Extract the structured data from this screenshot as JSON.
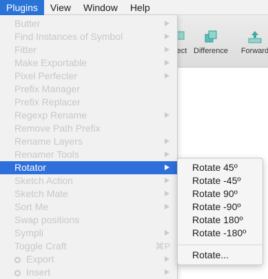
{
  "menubar": {
    "items": [
      {
        "label": "Plugins",
        "active": true
      },
      {
        "label": "View"
      },
      {
        "label": "Window"
      },
      {
        "label": "Help"
      }
    ]
  },
  "toolbar": {
    "intersect_label": "ect",
    "difference_label": "Difference",
    "forward_label": "Forward",
    "icon_color": "#3fa8a0"
  },
  "plugins_menu": {
    "items": [
      {
        "label": "Butter",
        "submenu": true
      },
      {
        "label": "Find Instances of Symbol",
        "submenu": true
      },
      {
        "label": "Fitter",
        "submenu": true
      },
      {
        "label": "Make Exportable",
        "submenu": true
      },
      {
        "label": "Pixel Perfecter",
        "submenu": true
      },
      {
        "label": "Prefix Manager",
        "submenu": false
      },
      {
        "label": "Prefix Replacer",
        "submenu": false
      },
      {
        "label": "Regexp Rename",
        "submenu": true
      },
      {
        "label": "Remove Path Prefix",
        "submenu": false
      },
      {
        "label": "Rename Layers",
        "submenu": true
      },
      {
        "label": "Renamer Tools",
        "submenu": true
      },
      {
        "label": "Rotator",
        "submenu": true,
        "selected": true
      },
      {
        "label": "Sketch Action",
        "submenu": true
      },
      {
        "label": "Sketch Mate",
        "submenu": true
      },
      {
        "label": "Sort Me",
        "submenu": true
      },
      {
        "label": "Swap positions",
        "submenu": false
      },
      {
        "label": "Sympli",
        "submenu": true
      },
      {
        "label": "Toggle Craft",
        "shortcut": "⌘P"
      },
      {
        "label": "Export",
        "submenu": true,
        "icon": "gear-icon"
      },
      {
        "label": "Insert",
        "submenu": true,
        "icon": "gear-icon"
      }
    ]
  },
  "submenu": {
    "items": [
      {
        "label": "Rotate 45º"
      },
      {
        "label": "Rotate -45º"
      },
      {
        "label": "Rotate 90º"
      },
      {
        "label": "Rotate -90º"
      },
      {
        "label": "Rotate 180º"
      },
      {
        "label": "Rotate -180º"
      }
    ],
    "extra": {
      "label": "Rotate..."
    }
  },
  "colors": {
    "accent": "#2f6fdb",
    "disabled_text": "#c8c8c8"
  }
}
